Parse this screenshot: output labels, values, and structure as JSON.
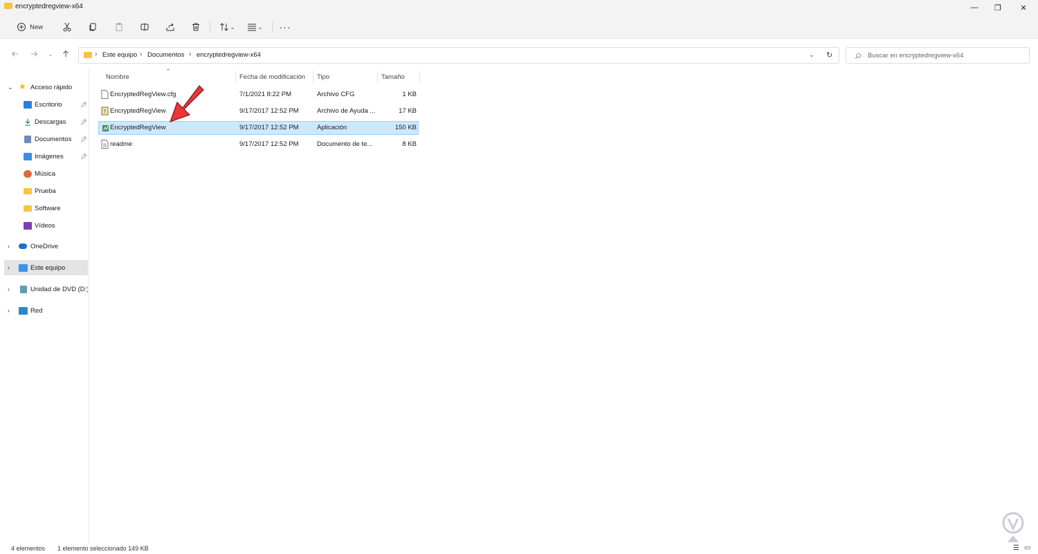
{
  "window": {
    "title": "encryptedregview-x64",
    "minimize_glyph": "—",
    "restore_glyph": "❐",
    "close_glyph": "✕"
  },
  "toolbar": {
    "new_label": "New",
    "items": [
      "new",
      "cut",
      "copy",
      "paste",
      "rename",
      "share",
      "delete",
      "sort",
      "view",
      "more"
    ]
  },
  "breadcrumb": {
    "items": [
      "Este equipo",
      "Documentos",
      "encryptedregview-x64"
    ]
  },
  "search": {
    "placeholder": "Buscar en encryptedregview-x64"
  },
  "sidebar": {
    "quick_access": "Acceso rápido",
    "items": [
      {
        "label": "Escritorio",
        "icon": "desktop-icon",
        "pinned": true
      },
      {
        "label": "Descargas",
        "icon": "download-icon",
        "pinned": true
      },
      {
        "label": "Documentos",
        "icon": "documents-icon",
        "pinned": true
      },
      {
        "label": "Imágenes",
        "icon": "images-icon",
        "pinned": true
      },
      {
        "label": "Música",
        "icon": "music-icon",
        "pinned": false
      },
      {
        "label": "Prueba",
        "icon": "folder-icon",
        "pinned": false
      },
      {
        "label": "Software",
        "icon": "folder-icon",
        "pinned": false
      },
      {
        "label": "Vídeos",
        "icon": "videos-icon",
        "pinned": false
      }
    ],
    "onedrive": "OneDrive",
    "this_pc": "Este equipo",
    "dvd": "Unidad de DVD (D:) (",
    "network": "Red"
  },
  "columns": {
    "name": "Nombre",
    "date": "Fecha de modificación",
    "type": "Tipo",
    "size": "Tamaño"
  },
  "files": [
    {
      "name": "EncryptedRegView.cfg",
      "date": "7/1/2021 8:22 PM",
      "type": "Archivo CFG",
      "size": "1 KB",
      "icon": "cfg-file-icon",
      "selected": false
    },
    {
      "name": "EncryptedRegView",
      "date": "9/17/2017 12:52 PM",
      "type": "Archivo de Ayuda ...",
      "size": "17 KB",
      "icon": "help-file-icon",
      "selected": false
    },
    {
      "name": "EncryptedRegView",
      "date": "9/17/2017 12:52 PM",
      "type": "Aplicación",
      "size": "150 KB",
      "icon": "application-icon",
      "selected": true
    },
    {
      "name": "readme",
      "date": "9/17/2017 12:52 PM",
      "type": "Documento de te...",
      "size": "8 KB",
      "icon": "text-file-icon",
      "selected": false
    }
  ],
  "status": {
    "count": "4 elementos",
    "selection": "1 elemento seleccionado  149 KB"
  },
  "colors": {
    "selection_bg": "#cce8ff",
    "selection_border": "#99d1ff",
    "folder": "#f6c343",
    "arrow": "#e8363b"
  }
}
